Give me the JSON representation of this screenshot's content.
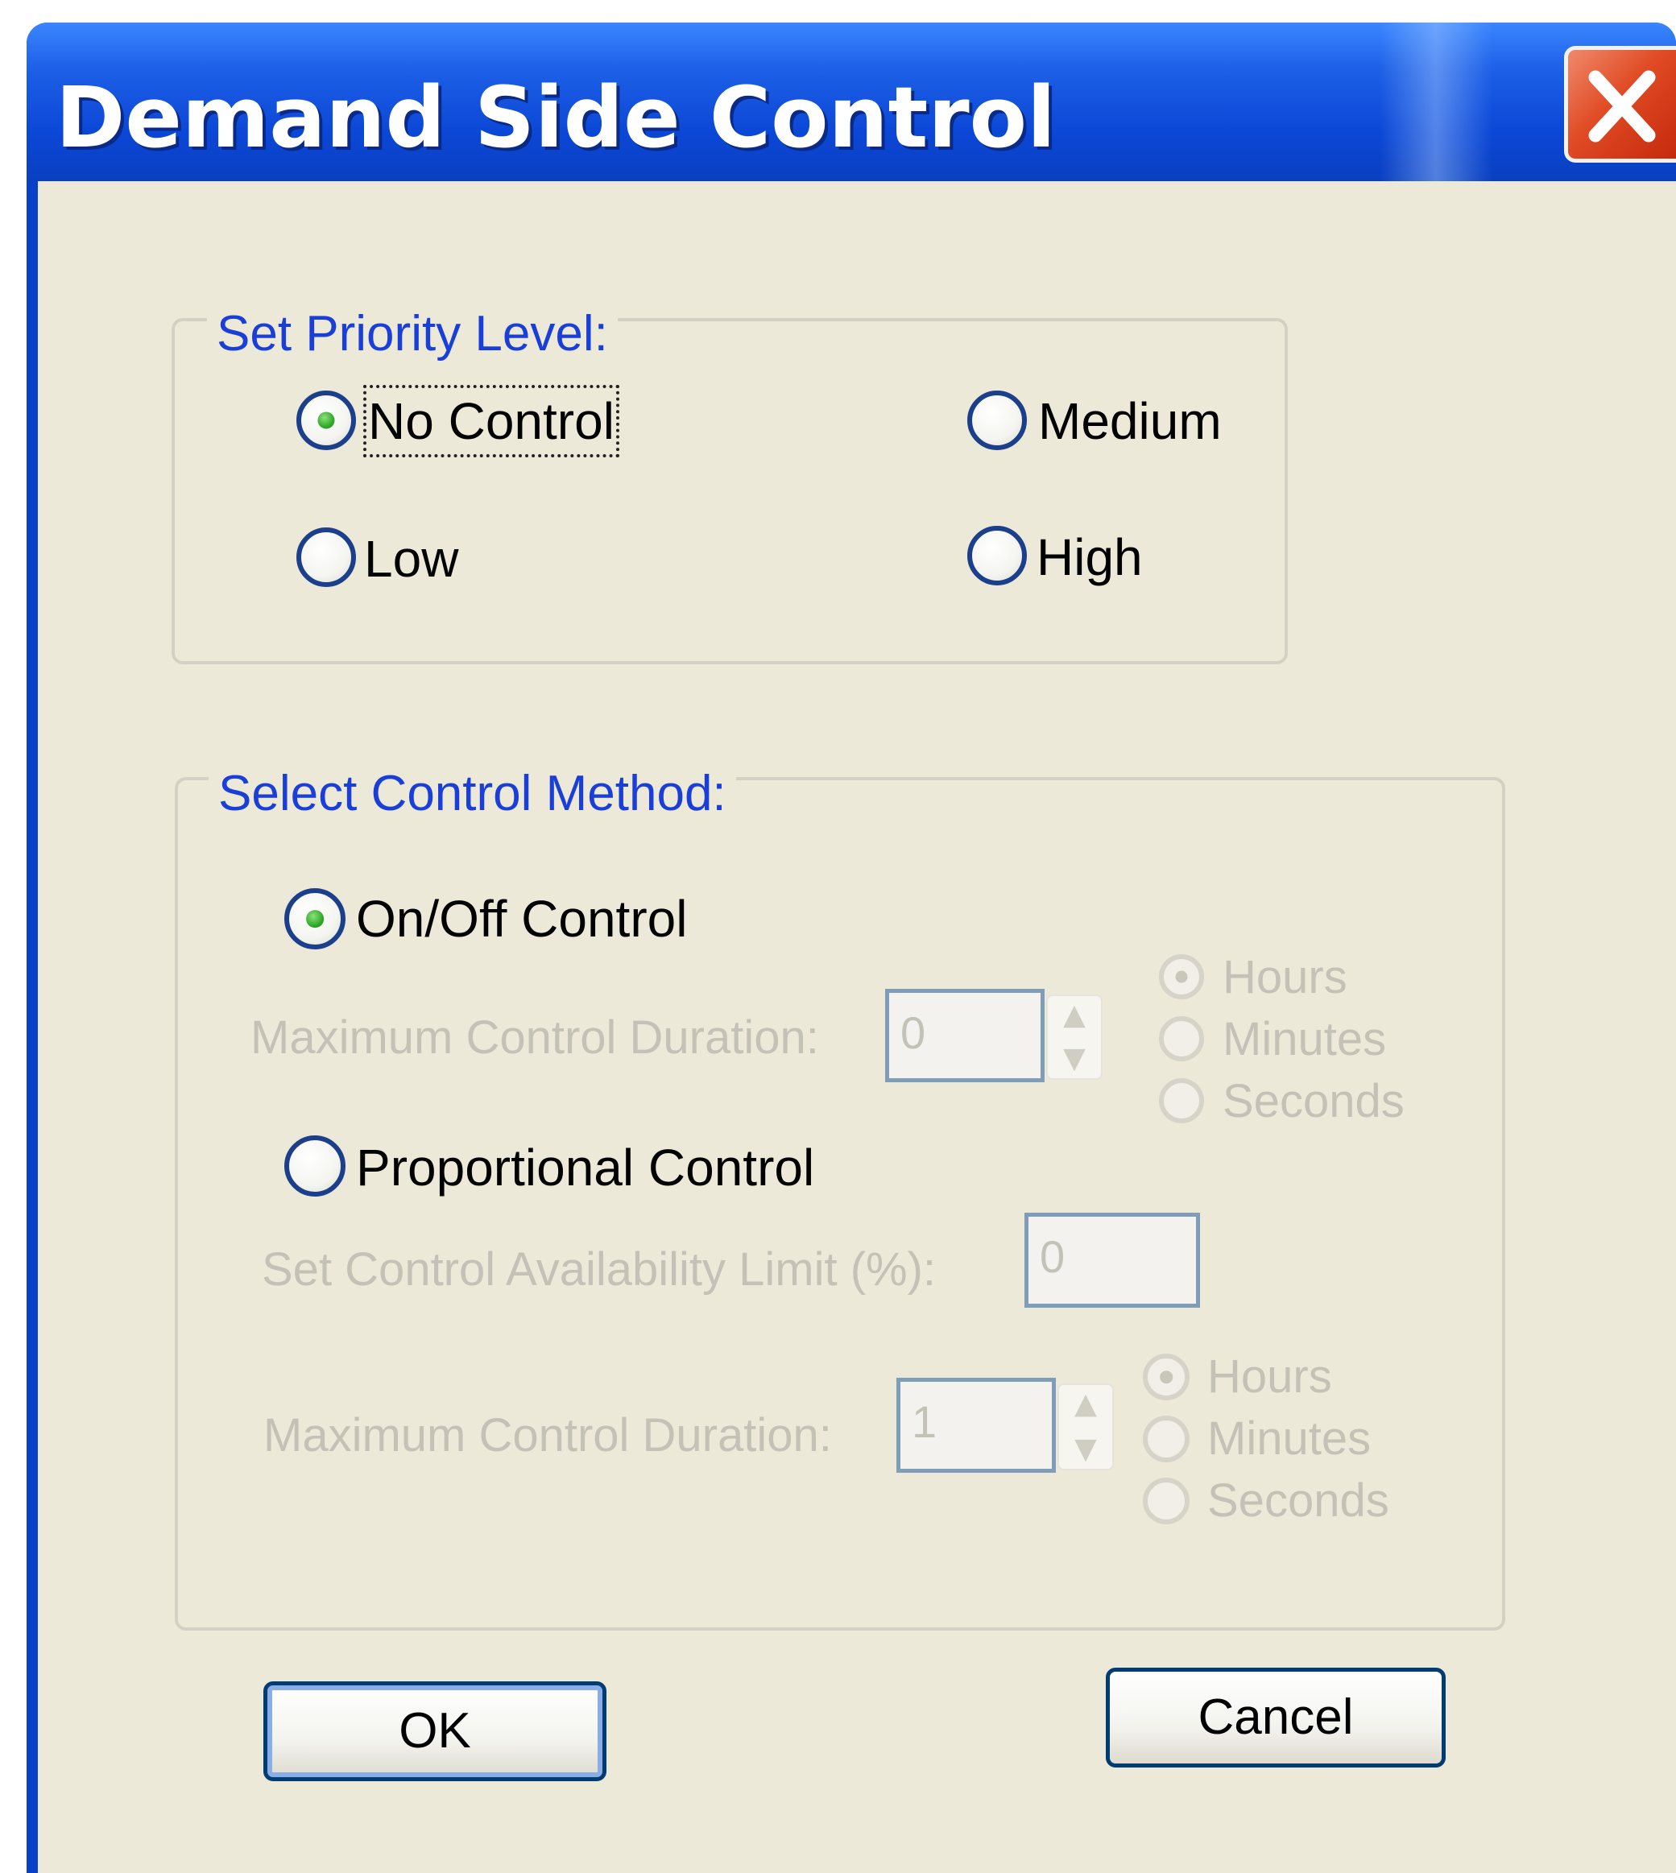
{
  "window": {
    "title": "Demand Side Control",
    "close_icon": "close-icon"
  },
  "priority": {
    "group_label": "Set Priority Level:",
    "options": [
      {
        "label": "No Control",
        "checked": true
      },
      {
        "label": "Medium",
        "checked": false
      },
      {
        "label": "Low",
        "checked": false
      },
      {
        "label": "High",
        "checked": false
      }
    ]
  },
  "method": {
    "group_label": "Select Control Method:",
    "onoff": {
      "label": "On/Off Control",
      "checked": true,
      "duration_label": "Maximum Control Duration:",
      "duration_value": "0",
      "units": [
        "Hours",
        "Minutes",
        "Seconds"
      ],
      "selected_unit": "Hours"
    },
    "proportional": {
      "label": "Proportional Control",
      "checked": false,
      "limit_label": "Set Control Availability Limit (%):",
      "limit_value": "0",
      "duration_label": "Maximum Control Duration:",
      "duration_value": "1",
      "units": [
        "Hours",
        "Minutes",
        "Seconds"
      ],
      "selected_unit": "Hours"
    }
  },
  "buttons": {
    "ok": "OK",
    "cancel": "Cancel"
  },
  "colors": {
    "title_bar": "#0b47d6",
    "client_bg": "#ece9d8",
    "group_label": "#1a3fd9",
    "close_button": "#e04a24",
    "radio_dot": "#2faa2a",
    "disabled_text": "#c4c1b6"
  }
}
